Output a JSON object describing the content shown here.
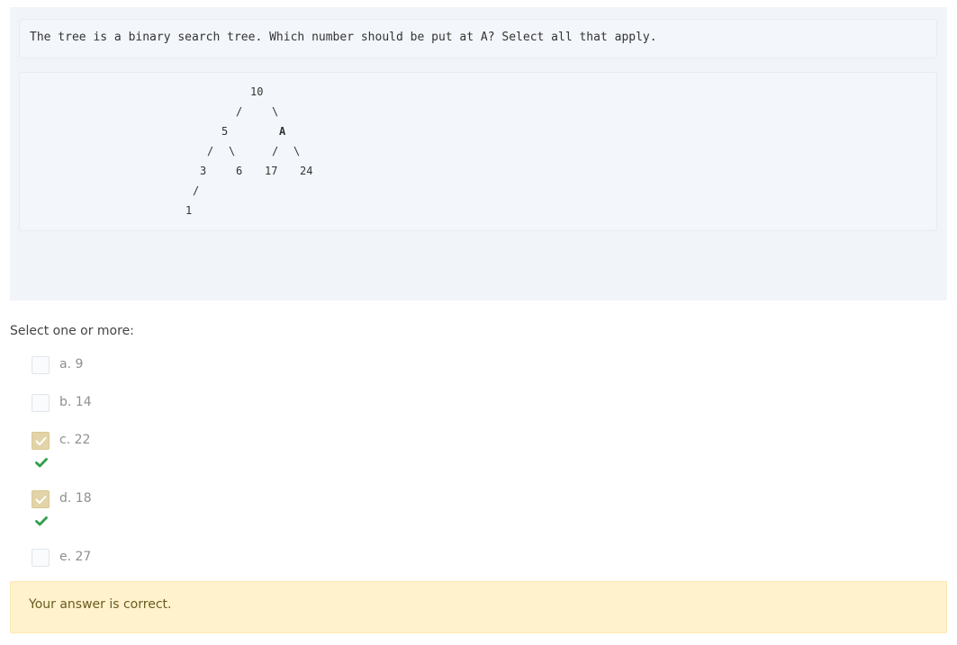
{
  "question": {
    "prompt": "The tree is a binary search tree. Which number should be put at A? Select all that apply.",
    "tree": {
      "root": "10",
      "left": "5",
      "right": "A",
      "left_left": "3",
      "left_right": "6",
      "right_left": "17",
      "right_right": "24",
      "left_left_left": "1",
      "edge_left": "/",
      "edge_right": "\\"
    }
  },
  "answer": {
    "prompt_label": "Select one or more:",
    "options": [
      {
        "label": "a. 9",
        "checked": false,
        "correct_mark": false
      },
      {
        "label": "b. 14",
        "checked": false,
        "correct_mark": false
      },
      {
        "label": "c. 22",
        "checked": true,
        "correct_mark": true
      },
      {
        "label": "d. 18",
        "checked": true,
        "correct_mark": true
      },
      {
        "label": "e. 27",
        "checked": false,
        "correct_mark": false
      }
    ]
  },
  "feedback": {
    "text": "Your answer is correct."
  },
  "colors": {
    "checked_box": "#e2d4a8",
    "correct_check": "#2e9e4a",
    "feedback_bg": "#fff2cc",
    "question_bg": "#f1f4f8"
  },
  "icons": {
    "box_check": "check-icon",
    "correct": "correct-check-icon"
  }
}
